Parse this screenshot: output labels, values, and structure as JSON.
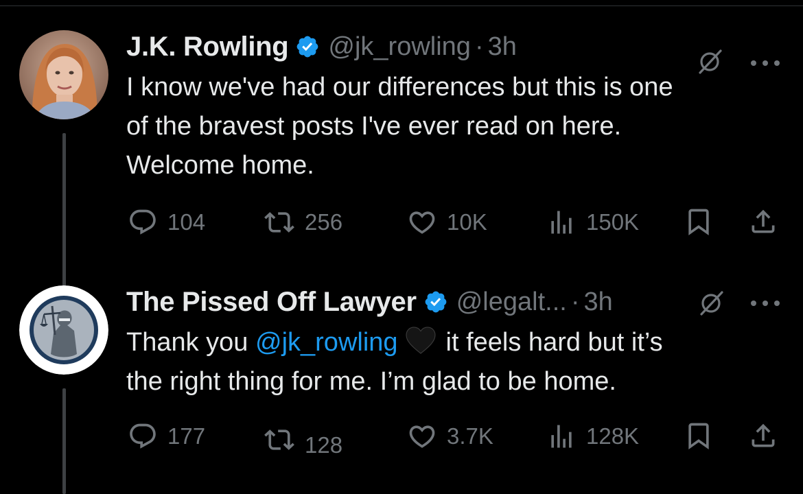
{
  "tweets": [
    {
      "name": "J.K. Rowling",
      "handle": "@jk_rowling",
      "separator": "·",
      "time": "3h",
      "text_lines": [
        "I know we've had our differences but this is one",
        "of the bravest posts I've ever read on here.",
        "Welcome home."
      ],
      "replies": "104",
      "reposts": "256",
      "likes": "10K",
      "views": "150K"
    },
    {
      "name": "The Pissed Off Lawyer",
      "handle": "@legalt...",
      "separator": "·",
      "time": "3h",
      "text_prefix": "Thank you ",
      "mention": "@jk_rowling",
      "emoji": "black-heart-emoji",
      "text_suffix": "it feels hard but it’s",
      "text_line2": "the right thing for me. I’m glad to be home.",
      "replies": "177",
      "reposts": "128",
      "likes": "3.7K",
      "views": "128K"
    }
  ],
  "colors": {
    "background": "#000000",
    "text": "#e7e9ea",
    "secondary": "#71767b",
    "verified": "#1d9bf0",
    "mention": "#1d9bf0",
    "thread_line": "#3e4144"
  },
  "icons": [
    "verified-badge-icon",
    "grok-icon",
    "more-icon",
    "reply-icon",
    "repost-icon",
    "like-icon",
    "views-icon",
    "bookmark-icon",
    "share-icon"
  ]
}
